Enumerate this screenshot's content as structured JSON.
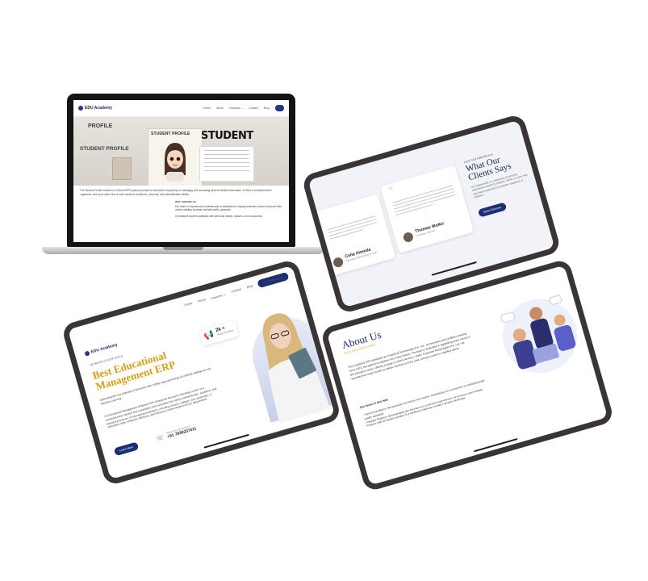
{
  "laptop": {
    "brand": "EDU Academy",
    "nav_links": [
      "Home",
      "About",
      "Features ⌄",
      "Contact",
      "Blog"
    ],
    "hero_words": {
      "profile": "PROFILE",
      "student_profile": "STUDENT PROFILE",
      "card_title": "STUDENT PROFILE",
      "student": "STUDENT"
    },
    "body_text": "The Student Profile module in a School ERP system provides a centralized repository for managing and accessing student-related information. It offers a comprehensive, organized, and up-to-date view of each student's academic, personal, and administrative details.",
    "why_label": "WHY CHOOSE US",
    "why_text": "Our team of experienced professionals is dedicated to helping business owners enhance their online visibility, increase website traffic, generate.",
    "bullet_text": "Centralized student database with personal details, classes, and documents."
  },
  "testimonials": {
    "section_label": "OUR TESTIMONIALS",
    "title": "What Our Clients Says",
    "intro": "Our Testimonials is a celebration of personal experiences shared by students, clients, or users who have been inspired by our website, programs, or initiatives.",
    "button": "Show Reviews",
    "cards": [
      {
        "name": "Celia Almeda",
        "role": "Secretary Administrative Staff"
      },
      {
        "name": "Thomas Moller",
        "role": "Company Director"
      }
    ]
  },
  "hero_erp": {
    "brand": "EDU Academy",
    "nav_links": [
      "Home",
      "About",
      "Features ⌄",
      "Contact",
      "Blog"
    ],
    "nav_button": "Schedule a Call",
    "intro_label": "INTRODUCTION EDUS",
    "title_line1": "Best Educational",
    "title_line2": "Management ERP",
    "desc1": "Optimizing the true potential of education with cutting-edge technology by Artificial Intelligence and Machine Learning",
    "desc2": "An Educational Management Software ERP (Enterprise Resource Planning) system is a comprehensive solution that streamlines and automates the various administrative, academic, and financial processes of educational institutions, including schools, colleges, and universities. It centralizes data, enhances efficiency, and improves communication across departments.",
    "learn_button": "Learn More",
    "phone_question": "Have Any Questions?",
    "phone_number": "+91 7838237011",
    "stat_value": "2k +",
    "stat_label": "Happy Students"
  },
  "about": {
    "title": "About Us",
    "subtitle": "Know About ERP Academy",
    "text": "EDU Academy ERP developed by Expertical Technologies Pvt. Ltd., an innovative and certified company since 2022, has gained recognition from many brands. The team is dedicated to digitalizing every school in the education sector, offering a range of school services. Under Expertical Technologies Pvt. Ltd., we launched five major brands to deliver services to every area, serving numerous satisfied clients.",
    "focus_label": "Our focus is few fold:",
    "points": [
      "Service Excellence: We guarantee top service and support, emphasizing our commitment to maintaining high quality standards.",
      "Regular Progress: Acknowledging the importance of continuous improvement, we introduce new modules. Progress without regular upgrades is a significant challenge in today's dynamic landscape."
    ]
  }
}
